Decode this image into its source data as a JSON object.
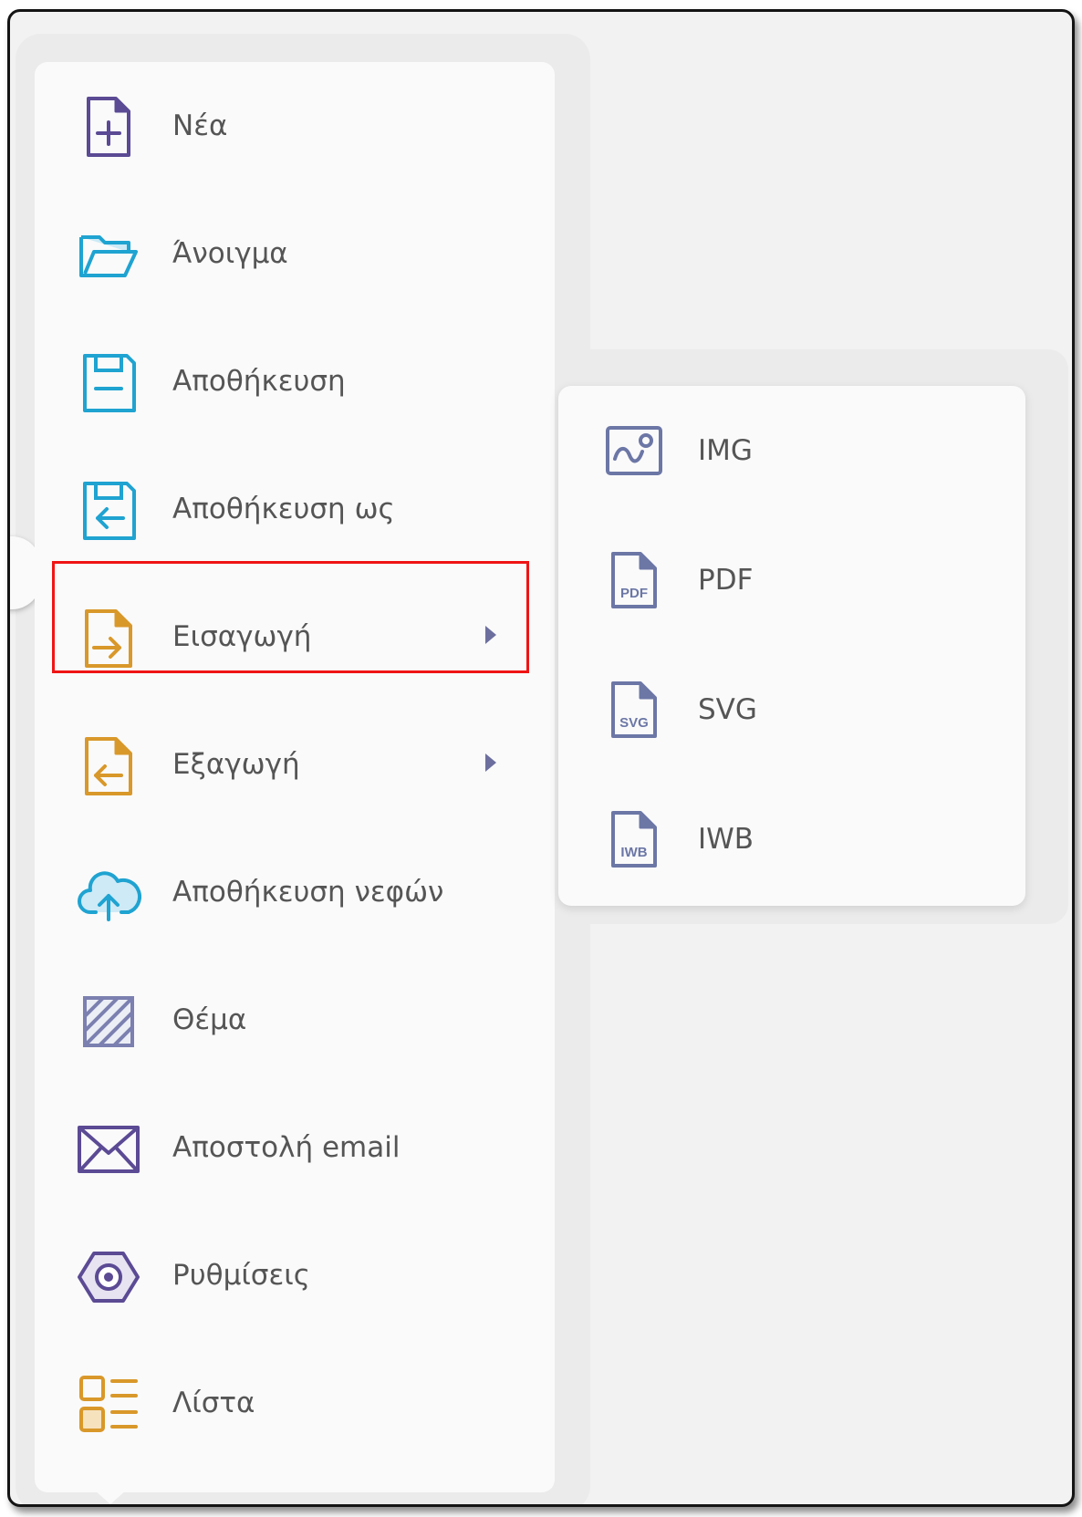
{
  "menu": {
    "items": [
      {
        "label": "Νέα",
        "icon": "new-file-plus-icon",
        "color": "#5b4a94"
      },
      {
        "label": "Άνοιγμα",
        "icon": "open-folder-icon",
        "color": "#1fa3d1"
      },
      {
        "label": "Αποθήκευση",
        "icon": "floppy-save-icon",
        "color": "#1fa3d1"
      },
      {
        "label": "Αποθήκευση ως",
        "icon": "floppy-save-as-icon",
        "color": "#1fa3d1"
      },
      {
        "label": "Εισαγωγή",
        "icon": "import-file-icon",
        "color": "#d9982a",
        "submenu": true
      },
      {
        "label": "Εξαγωγή",
        "icon": "export-file-icon",
        "color": "#d9982a",
        "submenu": true
      },
      {
        "label": "Αποθήκευση νεφών",
        "icon": "cloud-upload-icon",
        "color": "#1fa3d1"
      },
      {
        "label": "Θέμα",
        "icon": "theme-pattern-icon",
        "color": "#7b80b0"
      },
      {
        "label": "Αποστολή email",
        "icon": "envelope-icon",
        "color": "#5b4a94"
      },
      {
        "label": "Ρυθμίσεις",
        "icon": "settings-hexagon-icon",
        "color": "#5b4a94"
      },
      {
        "label": "Λίστα",
        "icon": "list-icon",
        "color": "#d9982a"
      }
    ]
  },
  "submenu": {
    "items": [
      {
        "label": "IMG",
        "icon": "image-file-icon",
        "tag": ""
      },
      {
        "label": "PDF",
        "icon": "pdf-file-icon",
        "tag": "PDF"
      },
      {
        "label": "SVG",
        "icon": "svg-file-icon",
        "tag": "SVG"
      },
      {
        "label": "IWB",
        "icon": "iwb-file-icon",
        "tag": "IWB"
      }
    ],
    "color": "#6c77a6"
  },
  "colors": {
    "highlight": "#f01414",
    "text": "#555555"
  }
}
